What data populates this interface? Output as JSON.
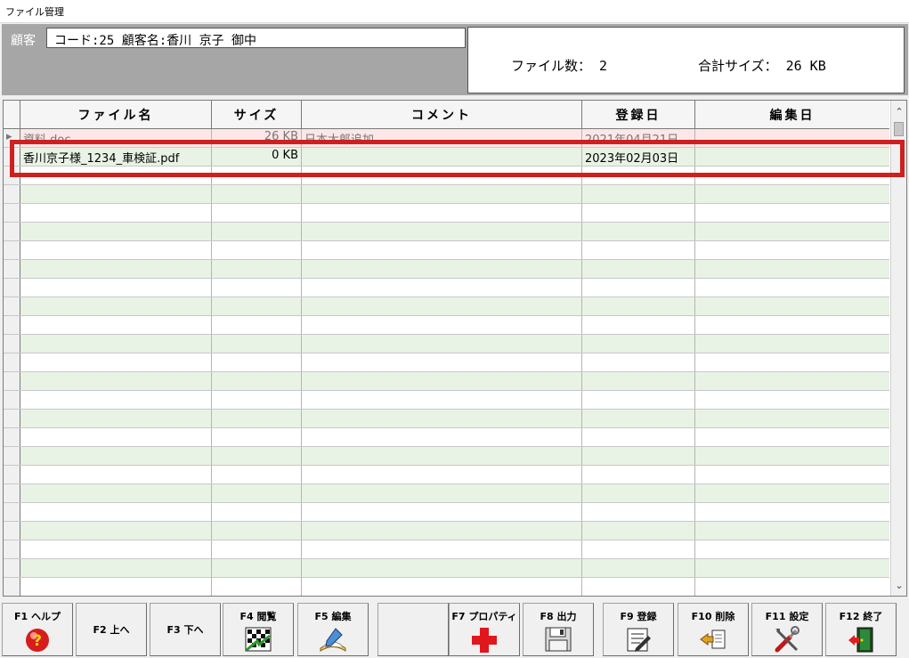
{
  "window": {
    "title": "ファイル管理"
  },
  "customer": {
    "label": "顧客",
    "value": "コード:25 顧客名:香川 京子 御中"
  },
  "stats": {
    "file_count": "ファイル数： 2",
    "total_size": "合計サイズ： 26 KB"
  },
  "grid": {
    "columns": [
      "ファイル名",
      "サイズ",
      "コメント",
      "登録日",
      "編集日"
    ],
    "rows": [
      {
        "name": "資料.doc",
        "size": "26 KB",
        "comment": "日本太郎追加",
        "registered": "2021年04月21日",
        "edited": ""
      },
      {
        "name": "香川京子様_1234_車検証.pdf",
        "size": "0 KB",
        "comment": "",
        "registered": "2023年02月03日",
        "edited": ""
      }
    ],
    "selected_row": 1
  },
  "toolbar": [
    {
      "label": "F1 ヘルプ",
      "icon": "help-icon"
    },
    {
      "label": "F2 上へ",
      "icon": ""
    },
    {
      "label": "F3 下へ",
      "icon": ""
    },
    {
      "label": "F4 閲覧",
      "icon": "view-icon"
    },
    {
      "label": "F5 編集",
      "icon": "edit-icon"
    },
    {
      "label": "",
      "icon": ""
    },
    {
      "label": "F7 プロパティ",
      "icon": "properties-icon"
    },
    {
      "label": "F8 出力",
      "icon": "save-icon"
    },
    {
      "label": "F9 登録",
      "icon": "register-icon"
    },
    {
      "label": "F10 削除",
      "icon": "delete-icon"
    },
    {
      "label": "F11 設定",
      "icon": "settings-icon"
    },
    {
      "label": "F12 終了",
      "icon": "exit-icon"
    }
  ],
  "colors": {
    "header_bg": "#a6a6a6",
    "row_alt": "#e9f3e5",
    "highlight": "#d01f1f"
  }
}
